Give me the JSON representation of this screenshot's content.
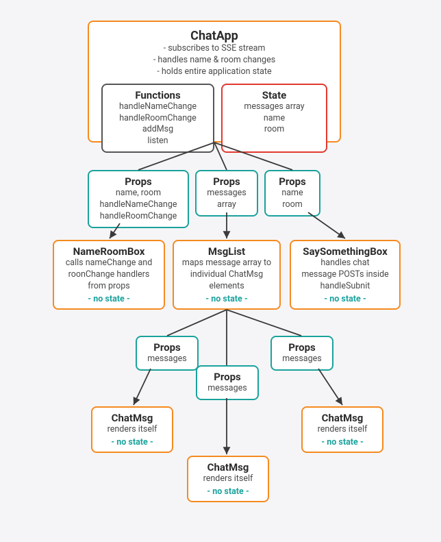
{
  "chatapp": {
    "title": "ChatApp",
    "lines": [
      "- subscribes to SSE stream",
      "- handles name & room changes",
      "- holds entire application state"
    ],
    "functions": {
      "title": "Functions",
      "items": [
        "handleNameChange",
        "handleRoomChange",
        "addMsg",
        "listen"
      ]
    },
    "state": {
      "title": "State",
      "items": [
        "messages array",
        "name",
        "room"
      ]
    }
  },
  "props": {
    "left": {
      "title": "Props",
      "items": [
        "name, room",
        "handleNameChange",
        "handleRoomChange"
      ]
    },
    "mid": {
      "title": "Props",
      "items": [
        "messages",
        "array"
      ]
    },
    "right": {
      "title": "Props",
      "items": [
        "name",
        "room"
      ]
    }
  },
  "row2": {
    "nameRoom": {
      "title": "NameRoomBox",
      "lines": [
        "calls nameChange and",
        "roonChange handlers",
        "from props"
      ],
      "nostate": "- no state -"
    },
    "msgList": {
      "title": "MsgList",
      "lines": [
        "maps message array to",
        "individual ChatMsg",
        "elements"
      ],
      "nostate": "- no state -"
    },
    "saySome": {
      "title": "SaySomethingBox",
      "lines": [
        "handles chat",
        "message POSTs inside",
        "handleSubnit"
      ],
      "nostate": "- no state -"
    }
  },
  "msgProps": {
    "l": {
      "title": "Props",
      "item": "messages"
    },
    "m": {
      "title": "Props",
      "item": "messages"
    },
    "r": {
      "title": "Props",
      "item": "messages"
    }
  },
  "chatmsg": {
    "l": {
      "title": "ChatMsg",
      "line": "renders itself",
      "nostate": "- no state -"
    },
    "m": {
      "title": "ChatMsg",
      "line": "renders itself",
      "nostate": "- no state -"
    },
    "r": {
      "title": "ChatMsg",
      "line": "renders itself",
      "nostate": "- no state -"
    }
  }
}
